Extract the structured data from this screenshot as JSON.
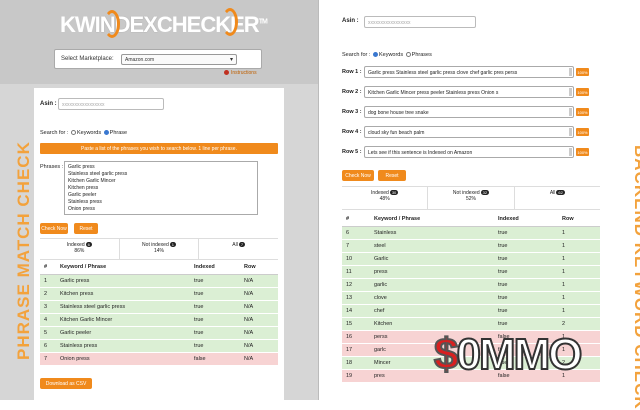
{
  "logo": {
    "text_kw": "KW",
    "text_index": "INDEX",
    "text_checker": "CHECKER",
    "tm": "TM"
  },
  "marketplace": {
    "label": "Select Marketplace:",
    "value": "Amazon.com",
    "instructions": "Instructions"
  },
  "left_panel": {
    "vertical_label": "PHRASE MATCH CHECK",
    "asin_label": "Asin :",
    "asin_value": "xxxxxxxxxxxxxxxxx",
    "search_for_label": "Search for :",
    "search_options": [
      "Keywords",
      "Phrase"
    ],
    "hint": "Paste a list of the phrases you wish to search below. 1 line per phrase.",
    "phrases_label": "Phrases :",
    "phrases": [
      "Garlic press",
      "Stainless steel garlic press",
      "Kitchen Garlic Mincer",
      "Kitchen press",
      "Garlic peeler",
      "Stainless press",
      "Onion press"
    ],
    "check_button": "Check Now",
    "reset_button": "Reset",
    "stats": [
      {
        "label": "Indexed",
        "count": "6",
        "pct": "86%"
      },
      {
        "label": "Not indexed",
        "count": "1",
        "pct": "14%"
      },
      {
        "label": "All",
        "count": "7",
        "pct": ""
      }
    ],
    "table_headers": [
      "#",
      "Keyword / Phrase",
      "Indexed",
      "Row"
    ],
    "rows": [
      {
        "n": "1",
        "kw": "Garlic press",
        "idx": "true",
        "row": "N/A",
        "status": "green"
      },
      {
        "n": "2",
        "kw": "Kitchen press",
        "idx": "true",
        "row": "N/A",
        "status": "green"
      },
      {
        "n": "3",
        "kw": "Stainless steel garlic press",
        "idx": "true",
        "row": "N/A",
        "status": "green"
      },
      {
        "n": "4",
        "kw": "Kitchen Garlic Mincer",
        "idx": "true",
        "row": "N/A",
        "status": "green"
      },
      {
        "n": "5",
        "kw": "Garlic peeler",
        "idx": "true",
        "row": "N/A",
        "status": "green"
      },
      {
        "n": "6",
        "kw": "Stainless press",
        "idx": "true",
        "row": "N/A",
        "status": "green"
      },
      {
        "n": "7",
        "kw": "Onion press",
        "idx": "false",
        "row": "N/A",
        "status": "red"
      }
    ],
    "download_button": "Download as CSV"
  },
  "right_panel": {
    "vertical_label": "BACKEND KEYWORD CHECK",
    "asin_label": "Asin :",
    "asin_value": "xxxxxxxxxxxxxxxxx",
    "search_for_label": "Search for :",
    "search_options": [
      "Keywords",
      "Phrases"
    ],
    "input_rows": [
      {
        "label": "Row 1 :",
        "value": "Garlic press Stainless steel garlic press clove chef garlic pres perss",
        "pct": "100%"
      },
      {
        "label": "Row 2 :",
        "value": "Kitchen Garlic Mincer press peeler Stainless press Onion s",
        "pct": "100%"
      },
      {
        "label": "Row 3 :",
        "value": "dog bone house tree snake",
        "pct": "100%"
      },
      {
        "label": "Row 4 :",
        "value": "cloud sky fun beach palm",
        "pct": "100%"
      },
      {
        "label": "Row 5 :",
        "value": "Lets see if this sentence is Indexed on Amazon",
        "pct": "100%"
      }
    ],
    "check_button": "Check Now",
    "reset_button": "Reset",
    "stats": [
      {
        "label": "Indexed",
        "count": "30",
        "pct": "48%"
      },
      {
        "label": "Not indexed",
        "count": "32",
        "pct": "52%"
      },
      {
        "label": "All",
        "count": "62",
        "pct": ""
      }
    ],
    "table_headers": [
      "#",
      "Keyword / Phrase",
      "Indexed",
      "Row"
    ],
    "rows": [
      {
        "n": "6",
        "kw": "Stainless",
        "idx": "true",
        "row": "1",
        "status": "green"
      },
      {
        "n": "7",
        "kw": "steel",
        "idx": "true",
        "row": "1",
        "status": "green"
      },
      {
        "n": "10",
        "kw": "Garlic",
        "idx": "true",
        "row": "1",
        "status": "green"
      },
      {
        "n": "11",
        "kw": "press",
        "idx": "true",
        "row": "1",
        "status": "green"
      },
      {
        "n": "12",
        "kw": "garlic",
        "idx": "true",
        "row": "1",
        "status": "green"
      },
      {
        "n": "13",
        "kw": "clove",
        "idx": "true",
        "row": "1",
        "status": "green"
      },
      {
        "n": "14",
        "kw": "chef",
        "idx": "true",
        "row": "1",
        "status": "green"
      },
      {
        "n": "15",
        "kw": "Kitchen",
        "idx": "true",
        "row": "2",
        "status": "green"
      },
      {
        "n": "16",
        "kw": "perss",
        "idx": "false",
        "row": "1",
        "status": "red"
      },
      {
        "n": "17",
        "kw": "garlc",
        "idx": "false",
        "row": "1",
        "status": "red"
      },
      {
        "n": "18",
        "kw": "Mincer",
        "idx": "true",
        "row": "2",
        "status": "green"
      },
      {
        "n": "19",
        "kw": "pres",
        "idx": "false",
        "row": "1",
        "status": "red"
      }
    ]
  },
  "watermark": {
    "dollar": "$",
    "text": "0MMO"
  },
  "colors": {
    "accent": "#f08a1c",
    "indexed": "#dbefd4",
    "not_indexed": "#f7d3d3"
  }
}
